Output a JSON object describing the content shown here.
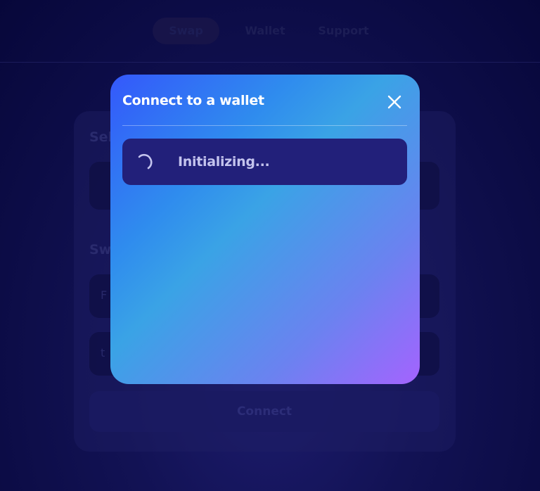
{
  "nav": {
    "tabs": [
      {
        "label": "Swap",
        "active": true
      },
      {
        "label": "Wallet",
        "active": false
      },
      {
        "label": "Support",
        "active": false
      }
    ]
  },
  "background_card": {
    "select_heading": "Sel",
    "swap_heading": "Sw",
    "field1_text": "",
    "field2_text": "F",
    "field3_text": "t",
    "connect_label": "Connect"
  },
  "modal": {
    "title": "Connect to a wallet",
    "close_icon": "close-icon",
    "status_text": "Initializing...",
    "spinner_icon": "spinner-icon"
  },
  "colors": {
    "page_bg": "#07073a",
    "modal_gradient_start": "#3458fb",
    "modal_gradient_mid": "#3aa3e6",
    "modal_gradient_end": "#a463fe",
    "status_box_bg": "#22207a",
    "status_text": "#c4c4ee"
  }
}
